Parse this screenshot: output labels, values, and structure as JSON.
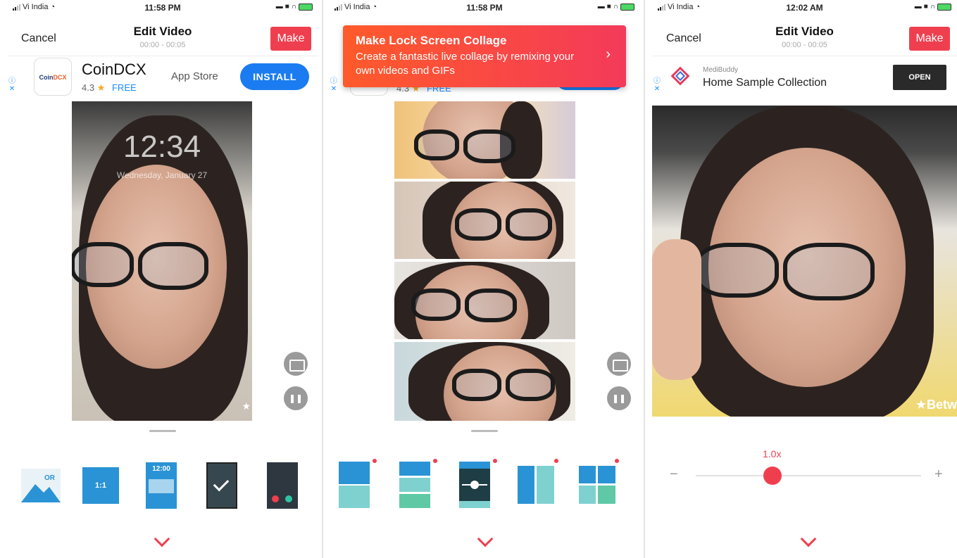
{
  "screens": [
    {
      "status": {
        "carrier": "Vi India",
        "time": "11:58 PM"
      },
      "nav": {
        "cancel": "Cancel",
        "title": "Edit Video",
        "subtitle": "00:00 - 00:05",
        "make": "Make"
      },
      "ad": {
        "logo_text_a": "Coin",
        "logo_text_b": "DCX",
        "name": "CoinDCX",
        "rating": "4.3",
        "star": "★",
        "price": "FREE",
        "store": "App Store",
        "cta": "INSTALL"
      },
      "lockscreen": {
        "clock": "12:34",
        "date": "Wednesday, January 27"
      },
      "float": {
        "calendar_icon": "calendar-icon",
        "pause_icon": "pause-icon"
      },
      "tools": [
        "image-or",
        "ratio-1-1",
        "lockscreen-12",
        "check-screen",
        "call-screen"
      ],
      "tool_labels": {
        "or": "OR",
        "ratio": "1:1",
        "clock": "12:00"
      }
    },
    {
      "status": {
        "carrier": "Vi India",
        "time": "11:58 PM"
      },
      "toast": {
        "title": "Make Lock Screen Collage",
        "body": "Create a fantastic live collage by remixing your own videos and GIFs",
        "arrow": "›"
      },
      "ad_partial": {
        "rating": "4.3",
        "star": "★",
        "price": "FREE"
      },
      "tools": [
        "layout-2-rows",
        "layout-3-rows",
        "layout-slider",
        "layout-2-cols",
        "layout-grid-4"
      ]
    },
    {
      "status": {
        "carrier": "Vi India",
        "time": "12:02 AM"
      },
      "nav": {
        "cancel": "Cancel",
        "title": "Edit Video",
        "subtitle": "00:00 - 00:05",
        "make": "Make"
      },
      "ad": {
        "brand": "MediBuddy",
        "title": "Home Sample Collection",
        "cta": "OPEN"
      },
      "overlay_text": "★Betw",
      "speed": {
        "label": "1.0x",
        "value": 1.0,
        "minus": "−",
        "plus": "+"
      }
    }
  ],
  "colors": {
    "accent": "#ef3f4f",
    "install": "#1a7cf0",
    "tool_blue": "#2a93d5",
    "tool_teal": "#7fd1cf"
  },
  "ad_info": {
    "info": "ⓘ",
    "close": "✕"
  }
}
